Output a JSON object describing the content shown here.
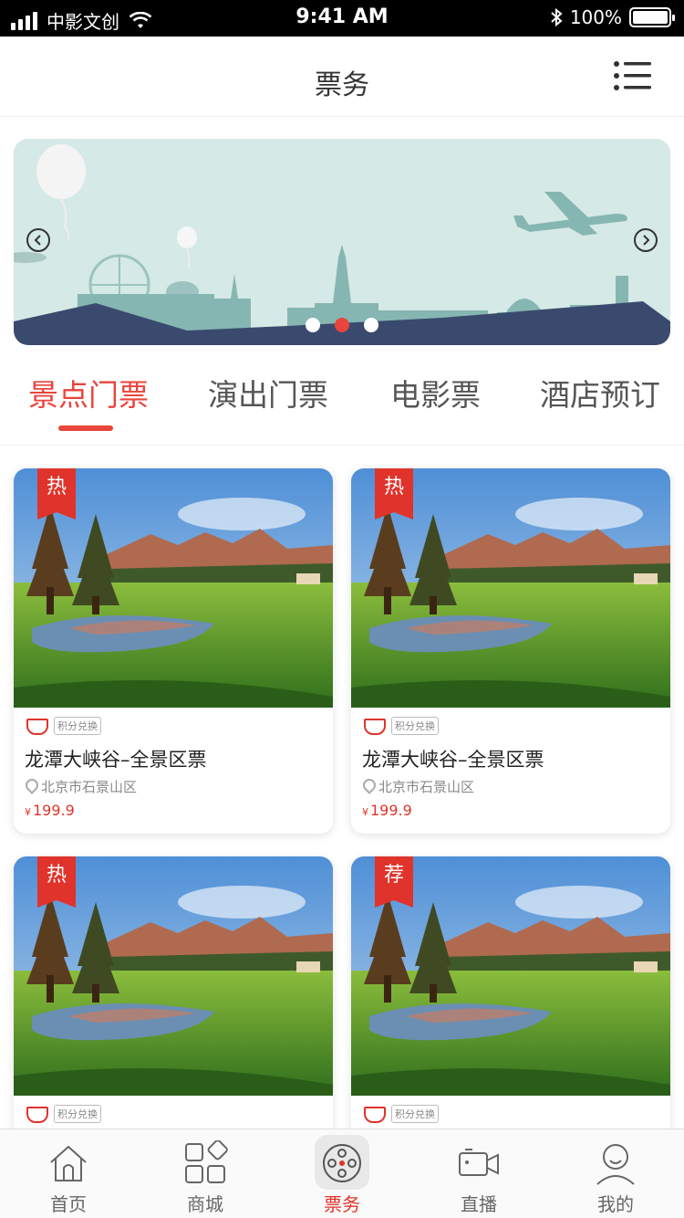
{
  "status_bar": {
    "carrier": "中影文创",
    "time": "9:41 AM",
    "battery": "100%",
    "battery_level": 1.0
  },
  "nav": {
    "title": "票务"
  },
  "banner": {
    "slide_count": 3,
    "active_slide": 2
  },
  "tabs": [
    {
      "label": "景点门票",
      "active": true
    },
    {
      "label": "演出门票",
      "active": false
    },
    {
      "label": "电影票",
      "active": false
    },
    {
      "label": "酒店预订",
      "active": false
    }
  ],
  "cards": [
    {
      "badge": "热",
      "tag": "积分兑换",
      "title": "龙潭大峡谷–全景区票",
      "location": "北京市石景山区",
      "currency": "¥",
      "price": "199.9"
    },
    {
      "badge": "热",
      "tag": "积分兑换",
      "title": "龙潭大峡谷–全景区票",
      "location": "北京市石景山区",
      "currency": "¥",
      "price": "199.9"
    },
    {
      "badge": "热",
      "tag": "积分兑换",
      "title": "",
      "location": "",
      "currency": "",
      "price": ""
    },
    {
      "badge": "荐",
      "tag": "积分兑换",
      "title": "",
      "location": "",
      "currency": "",
      "price": ""
    }
  ],
  "tabbar": [
    {
      "label": "首页",
      "icon": "home-icon",
      "active": false
    },
    {
      "label": "商城",
      "icon": "grid-icon",
      "active": false
    },
    {
      "label": "票务",
      "icon": "film-reel-icon",
      "active": true
    },
    {
      "label": "直播",
      "icon": "video-camera-icon",
      "active": false
    },
    {
      "label": "我的",
      "icon": "user-icon",
      "active": false
    }
  ],
  "colors": {
    "accent": "#e0332b",
    "banner_bg": "#d5e9e6",
    "banner_ground": "#3a4a6e",
    "skyline": "#86b6b2"
  }
}
